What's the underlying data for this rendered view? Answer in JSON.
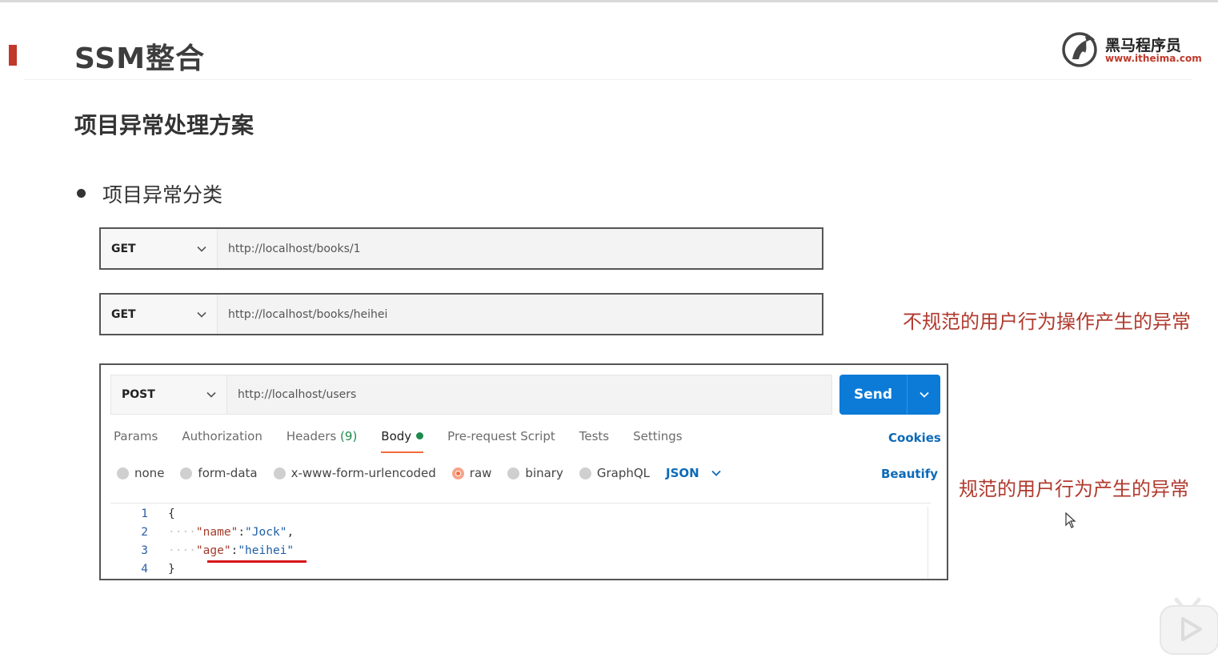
{
  "slide": {
    "title": "SSM整合",
    "section_title": "项目异常处理方案",
    "bullet": "项目异常分类"
  },
  "logo": {
    "name": "黑马程序员",
    "url": "www.itheima.com"
  },
  "requests": [
    {
      "method": "GET",
      "url": "http://localhost/books/1"
    },
    {
      "method": "GET",
      "url": "http://localhost/books/heihei"
    }
  ],
  "notes": {
    "irregular": "不规范的用户行为操作产生的异常",
    "regular": "规范的用户行为产生的异常"
  },
  "postman": {
    "method": "POST",
    "url": "http://localhost/users",
    "send_label": "Send",
    "tabs": {
      "params": "Params",
      "authorization": "Authorization",
      "headers": "Headers",
      "headers_count": "(9)",
      "body": "Body",
      "pre_request": "Pre-request Script",
      "tests": "Tests",
      "settings": "Settings"
    },
    "active_tab": "Body",
    "cookies": "Cookies",
    "body_modes": {
      "none": "none",
      "form_data": "form-data",
      "urlencoded": "x-www-form-urlencoded",
      "raw": "raw",
      "binary": "binary",
      "graphql": "GraphQL"
    },
    "selected_mode": "raw",
    "format": "JSON",
    "beautify": "Beautify",
    "code": {
      "l1": {
        "no": "1",
        "open": "{"
      },
      "l2": {
        "no": "2",
        "key": "\"name\"",
        "colon": ":",
        "value": "\"Jock\"",
        "comma": ","
      },
      "l3": {
        "no": "3",
        "key": "\"age\"",
        "colon": ":",
        "value": "\"heihei\""
      },
      "l4": {
        "no": "4",
        "close": "}"
      }
    }
  },
  "colors": {
    "accent": "#c0392b",
    "note_red": "#b03a2e",
    "send_blue": "#0c7bd8",
    "link_blue": "#0c6ab8",
    "active_tab_orange": "#f26b3a",
    "underline_red": "#d8141a"
  }
}
